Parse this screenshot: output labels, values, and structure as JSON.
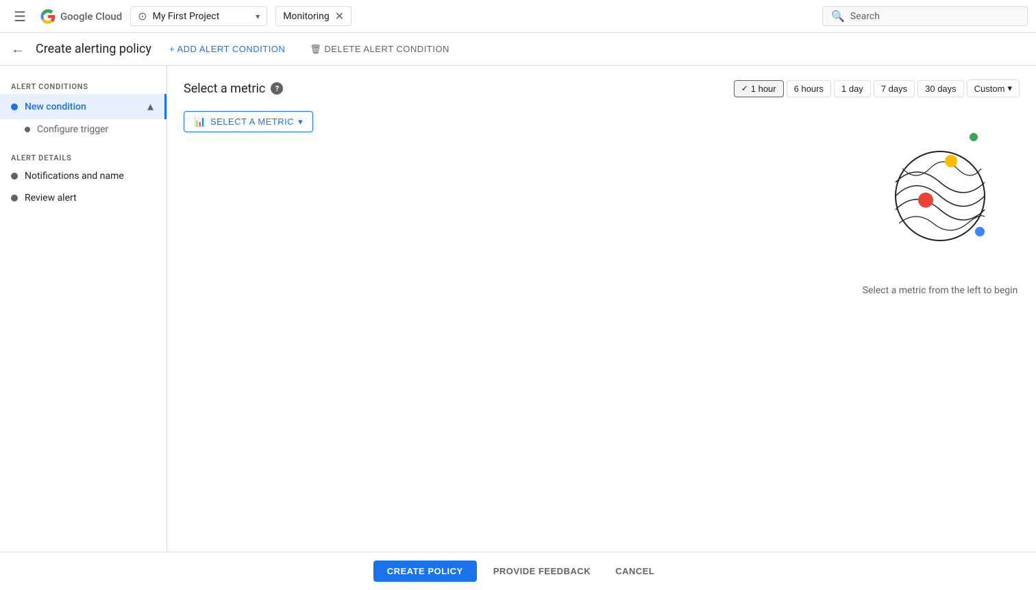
{
  "topNav": {
    "hamburger_label": "☰",
    "logo_text": "Google Cloud",
    "project_icon": "◉",
    "project_name": "My First Project",
    "project_arrow": "▾",
    "monitoring_label": "Monitoring",
    "clear_label": "✕",
    "search_icon": "🔍",
    "search_label": "Search"
  },
  "pageHeader": {
    "back_label": "←",
    "title": "Create alerting policy",
    "add_btn": "+ ADD ALERT CONDITION",
    "delete_btn": "🗑 DELETE ALERT CONDITION"
  },
  "sidebar": {
    "conditions_section": "ALERT CONDITIONS",
    "new_condition_label": "New condition",
    "configure_trigger_label": "Configure trigger",
    "details_section": "ALERT DETAILS",
    "notifications_label": "Notifications and name",
    "review_label": "Review alert"
  },
  "content": {
    "metric_title": "Select a metric",
    "help_label": "?",
    "select_metric_btn": "SELECT A METRIC",
    "select_metric_hint": "Select a metric from the left to begin",
    "time_options": [
      {
        "label": "1 hour",
        "active": true
      },
      {
        "label": "6 hours",
        "active": false
      },
      {
        "label": "1 day",
        "active": false
      },
      {
        "label": "7 days",
        "active": false
      },
      {
        "label": "30 days",
        "active": false
      },
      {
        "label": "Custom",
        "active": false,
        "has_arrow": true
      }
    ]
  },
  "bottomBar": {
    "create_policy_label": "CREATE POLICY",
    "feedback_label": "PROVIDE FEEDBACK",
    "cancel_label": "CANCEL"
  },
  "colors": {
    "blue": "#1a73e8",
    "green": "#34a853",
    "yellow": "#fbbc04",
    "red": "#ea4335",
    "dot_blue": "#4285f4"
  }
}
